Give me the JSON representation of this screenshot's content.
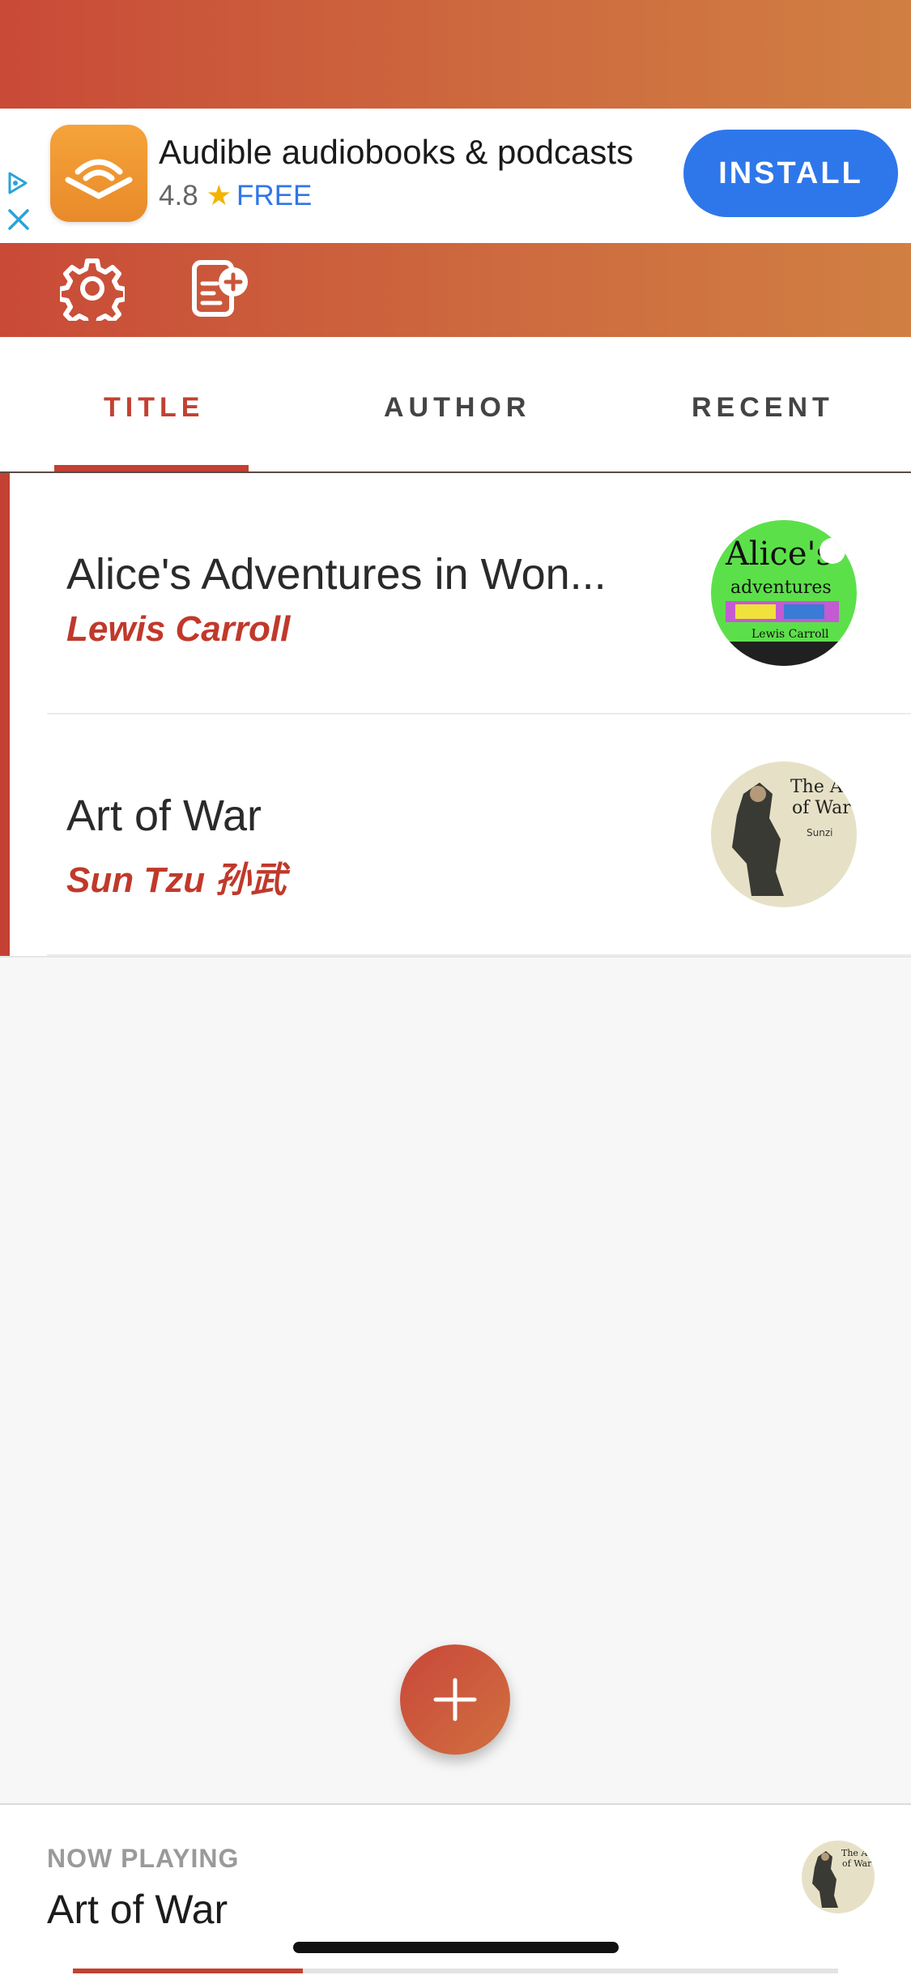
{
  "ad": {
    "title": "Audible audiobooks & podcasts",
    "rating": "4.8",
    "price": "FREE",
    "install_label": "INSTALL",
    "icons": [
      "ad-choices-icon",
      "close-icon",
      "audible-app-icon"
    ]
  },
  "toolbar": {
    "icons": [
      "gear-icon",
      "add-document-icon"
    ]
  },
  "tabs": {
    "items": [
      {
        "label": "TITLE",
        "active": true
      },
      {
        "label": "AUTHOR",
        "active": false
      },
      {
        "label": "RECENT",
        "active": false
      }
    ]
  },
  "books": [
    {
      "title": "Alice's Adventures in Won...",
      "author": "Lewis Carroll"
    },
    {
      "title": "Art of War",
      "author": "Sun Tzu 孙武"
    }
  ],
  "fab": {
    "icon": "plus-icon"
  },
  "now_playing": {
    "label": "NOW PLAYING",
    "title": "Art of War",
    "progress_fraction": 0.3
  },
  "colors": {
    "accent": "#c24133",
    "install_blue": "#2e77ea",
    "header_gradient_start": "#c94a37",
    "header_gradient_end": "#d17f42"
  }
}
